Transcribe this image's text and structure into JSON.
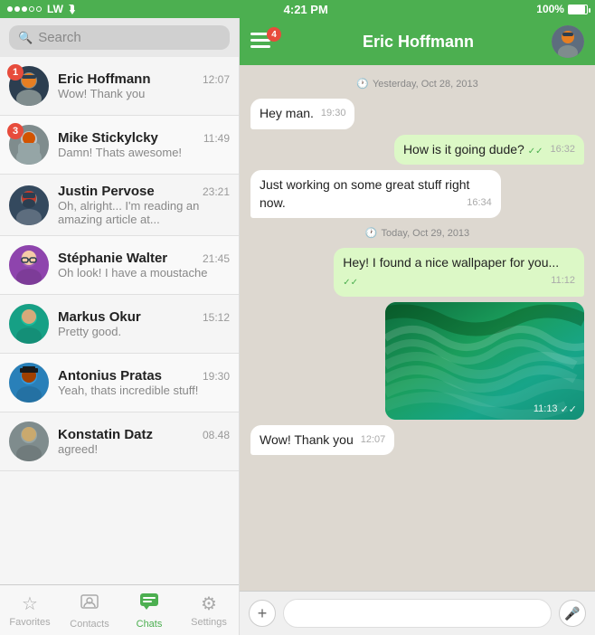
{
  "statusBar": {
    "signal": [
      "filled",
      "filled",
      "filled",
      "empty",
      "empty"
    ],
    "carrier": "LW",
    "time": "4:21 PM",
    "battery": "100%"
  },
  "search": {
    "placeholder": "Search"
  },
  "chats": [
    {
      "id": 1,
      "name": "Eric Hoffmann",
      "time": "12:07",
      "preview": "Wow! Thank you",
      "badge": "1",
      "hasBadge": true
    },
    {
      "id": 2,
      "name": "Mike Stickylcky",
      "time": "11:49",
      "preview": "Damn! Thats awesome!",
      "badge": "3",
      "hasBadge": true
    },
    {
      "id": 3,
      "name": "Justin Pervose",
      "time": "23:21",
      "preview": "Oh, alright... I'm reading an amazing article at...",
      "hasBadge": false
    },
    {
      "id": 4,
      "name": "Stéphanie Walter",
      "time": "21:45",
      "preview": "Oh look! I have a moustache",
      "hasBadge": false
    },
    {
      "id": 5,
      "name": "Markus Okur",
      "time": "15:12",
      "preview": "Pretty good.",
      "hasBadge": false
    },
    {
      "id": 6,
      "name": "Antonius Pratas",
      "time": "19:30",
      "preview": "Yeah, thats incredible stuff!",
      "hasBadge": false
    },
    {
      "id": 7,
      "name": "Konstatin Datz",
      "time": "08.48",
      "preview": "agreed!",
      "hasBadge": false
    }
  ],
  "tabs": [
    {
      "id": "favorites",
      "label": "Favorites",
      "icon": "★",
      "active": false
    },
    {
      "id": "contacts",
      "label": "Contacts",
      "icon": "👤",
      "active": false
    },
    {
      "id": "chats",
      "label": "Chats",
      "icon": "💬",
      "active": true
    },
    {
      "id": "settings",
      "label": "Settings",
      "icon": "⚙",
      "active": false
    }
  ],
  "chatHeader": {
    "title": "Eric Hoffmann",
    "menuBadge": "4"
  },
  "messages": [
    {
      "type": "date",
      "text": "Yesterday, Oct 28, 2013"
    },
    {
      "type": "incoming",
      "text": "Hey man.",
      "time": "19:30"
    },
    {
      "type": "outgoing",
      "text": "How is it going dude?",
      "time": "16:32",
      "ticks": "✓✓"
    },
    {
      "type": "incoming",
      "text": "Just working on some great stuff right now.",
      "time": "16:34"
    },
    {
      "type": "date",
      "text": "Today, Oct 29, 2013"
    },
    {
      "type": "outgoing",
      "text": "Hey! I found a nice wallpaper for you...",
      "time": "11:12",
      "ticks": "✓✓"
    },
    {
      "type": "outgoing-image",
      "time": "11:13",
      "ticks": "✓✓"
    },
    {
      "type": "incoming",
      "text": "Wow! Thank you",
      "time": "12:07"
    }
  ],
  "inputBar": {
    "placeholder": "",
    "addLabel": "+",
    "micLabel": "🎤"
  }
}
